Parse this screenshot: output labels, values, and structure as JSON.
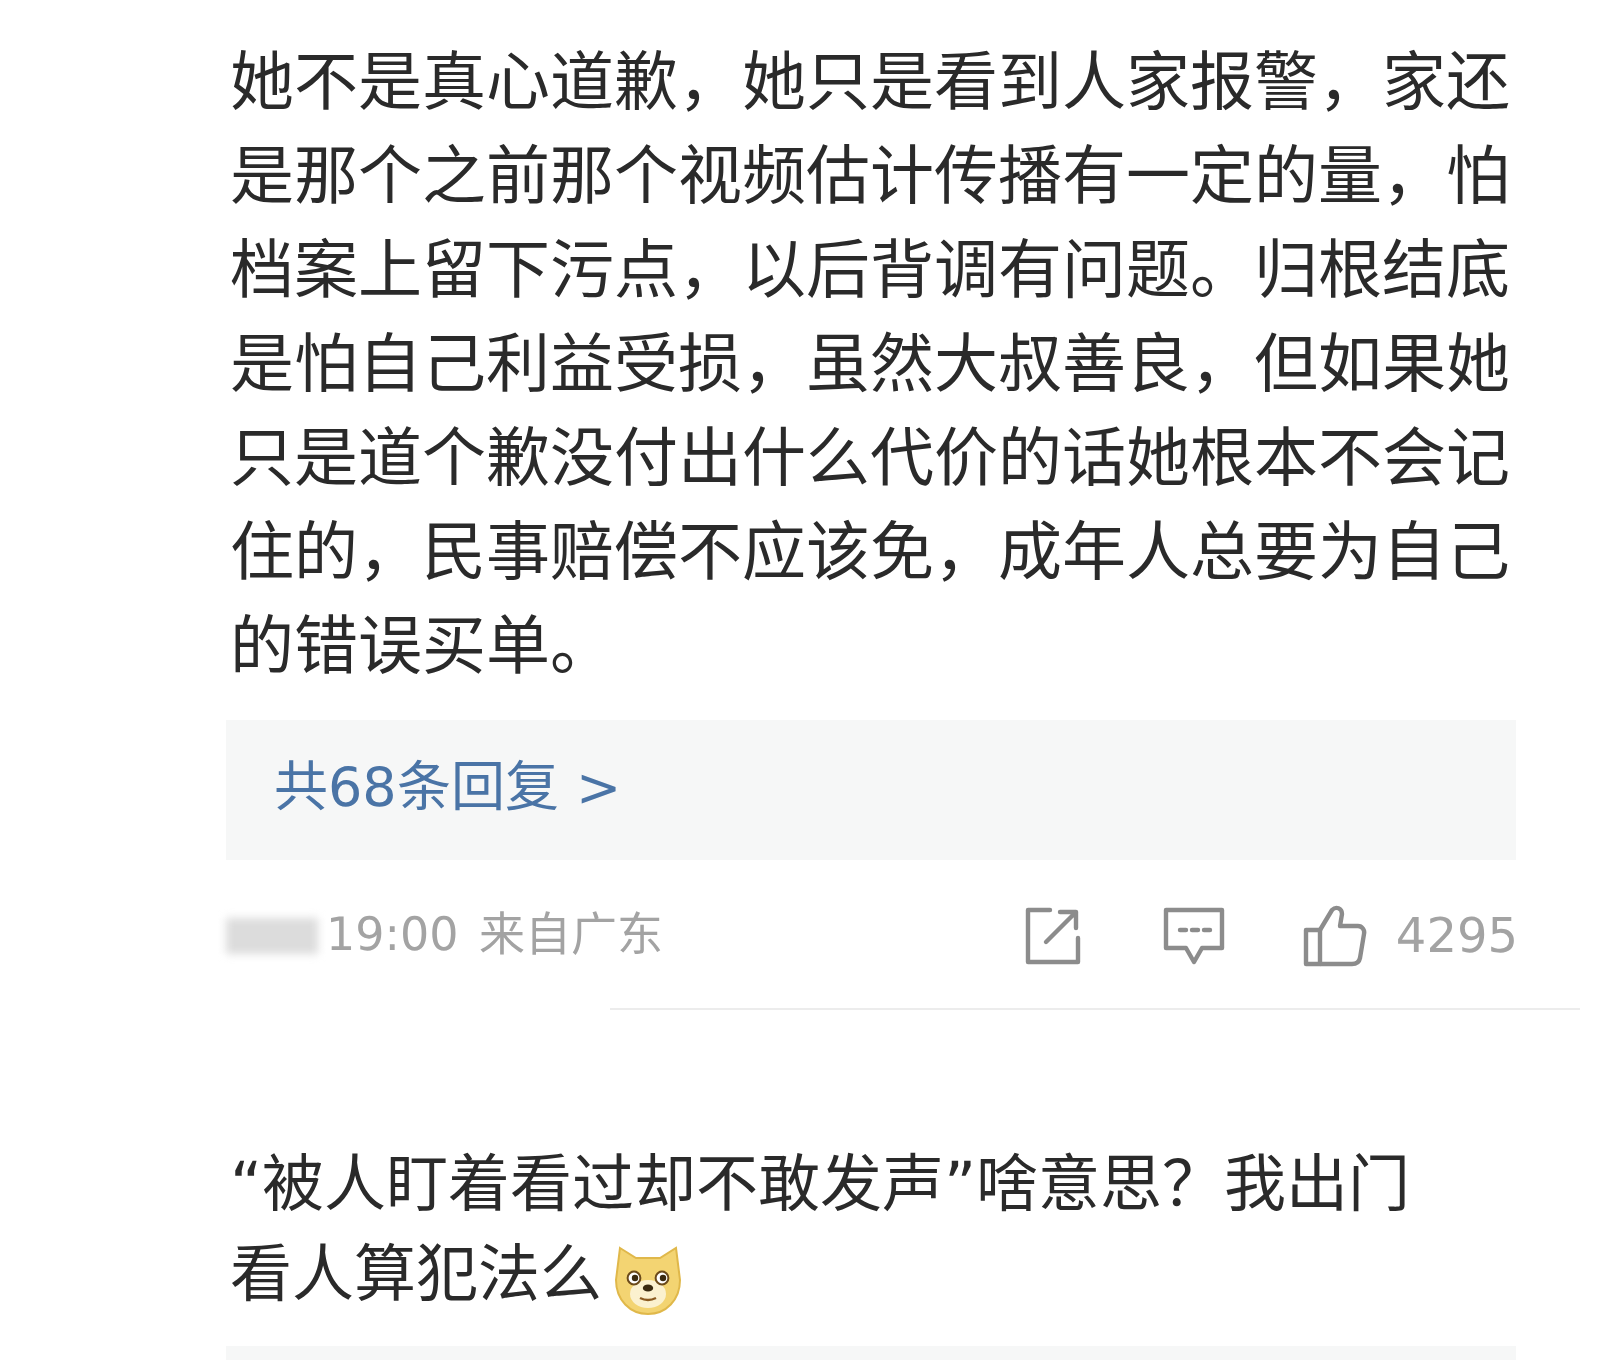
{
  "comment": {
    "text": "她不是真心道歉，她只是看到人家报警，家还是那个之前那个视频估计传播有一定的量，怕档案上留下污点，以后背调有问题。归根结底是怕自己利益受损，虽然大叔善良，但如果她只是道个歉没付出什么代价的话她根本不会记住的，民事赔偿不应该免，成年人总要为自己的错误买单。",
    "replies_link": "共68条回复 >",
    "time": "19:00",
    "location": "来自广东",
    "likes": "4295"
  },
  "next_comment": {
    "lines": [
      "“被人盯着看过却不敢发声”啥意思？我出门",
      "看人算犯法么"
    ]
  }
}
